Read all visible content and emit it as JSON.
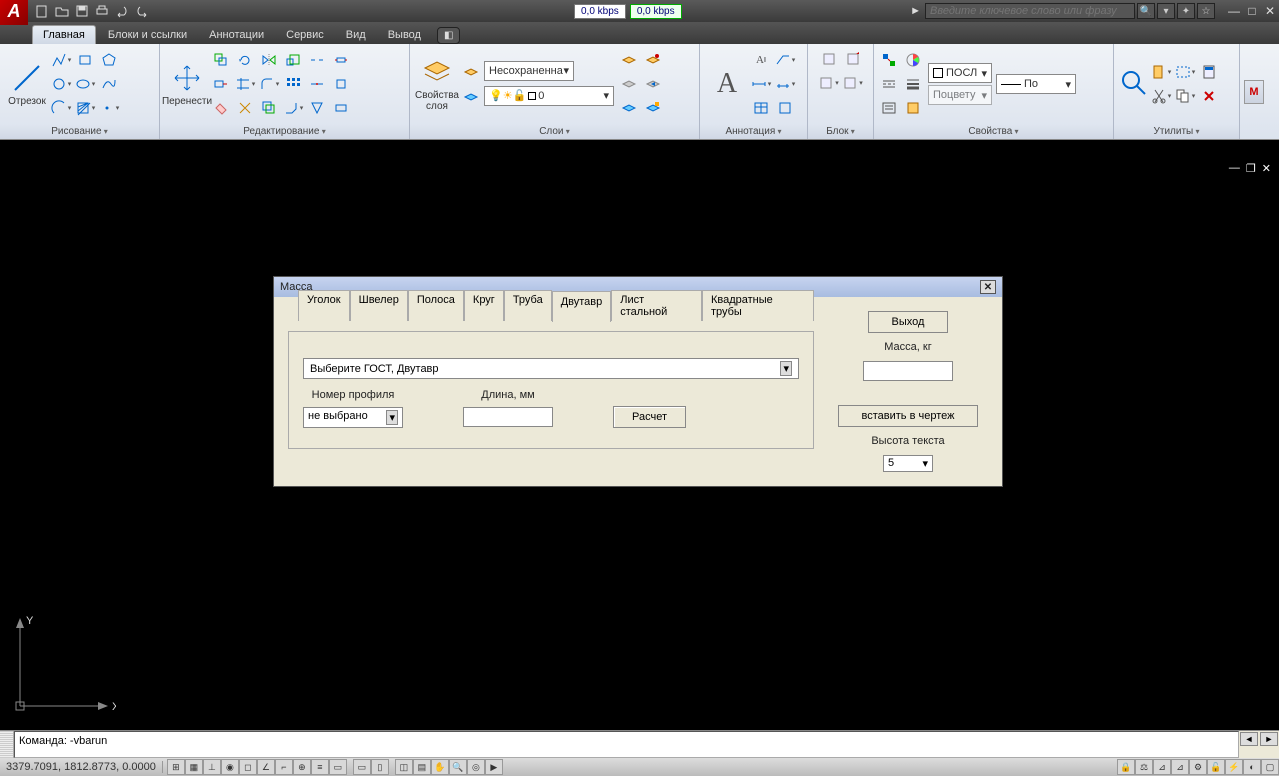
{
  "titlebar": {
    "speed1": "0,0 kbps",
    "speed2": "0,0 kbps",
    "search_placeholder": "Введите ключевое слово или фразу"
  },
  "ribbon": {
    "tabs": [
      "Главная",
      "Блоки и ссылки",
      "Аннотации",
      "Сервис",
      "Вид",
      "Вывод"
    ],
    "segment": {
      "lbl": "Отрезок"
    },
    "move": {
      "lbl": "Перенести"
    },
    "layerprop": {
      "lbl": "Свойства слоя"
    },
    "layerstate": "Несохраненна",
    "layercurrent": "0",
    "anno_A": "A",
    "panels": {
      "draw": "Рисование",
      "edit": "Редактирование",
      "layers": "Слои",
      "anno": "Аннотация",
      "block": "Блок",
      "props": "Свойства",
      "utils": "Утилиты"
    },
    "prop_bylayer": "ПОСЛ",
    "prop_lw": "По",
    "prop_color": "Поцвету",
    "side": "M"
  },
  "dialog": {
    "title": "Масса",
    "tabs": [
      "Уголок",
      "Швелер",
      "Полоса",
      "Круг",
      "Труба",
      "Двутавр",
      "Лист стальной",
      "Квадратные трубы"
    ],
    "gost": "Выберите ГОСТ, Двутавр",
    "profile_label": "Номер профиля",
    "profile_value": "не выбрано",
    "length_label": "Длина, мм",
    "calc": "Расчет",
    "exit": "Выход",
    "mass_label": "Масса, кг",
    "insert": "вставить в чертеж",
    "textheight_label": "Высота текста",
    "textheight_value": "5"
  },
  "cmd": "Команда: -vbarun",
  "status": {
    "coords": "3379.7091, 1812.8773, 0.0000"
  },
  "ucs": {
    "x": "X",
    "y": "Y"
  }
}
